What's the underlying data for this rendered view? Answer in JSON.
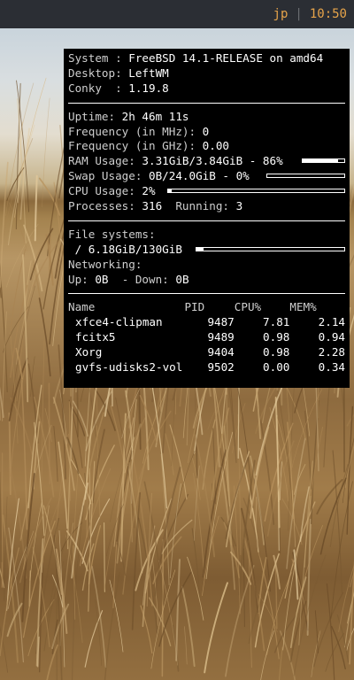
{
  "topbar": {
    "user": "jp",
    "separator": "|",
    "clock": "10:50"
  },
  "conky": {
    "system_label": "System :",
    "system_value": "FreeBSD 14.1-RELEASE on amd64",
    "desktop_label": "Desktop:",
    "desktop_value": "LeftWM",
    "conky_label": "Conky  :",
    "conky_value": "1.19.8",
    "uptime_label": "Uptime:",
    "uptime_value": "2h 46m 11s",
    "freq_mhz_label": "Frequency (in MHz):",
    "freq_mhz_value": "0",
    "freq_ghz_label": "Frequency (in GHz):",
    "freq_ghz_value": "0.00",
    "ram_label": "RAM Usage:",
    "ram_value": "3.31GiB/3.84GiB - 86%",
    "ram_fraction": 0.86,
    "swap_label": "Swap Usage:",
    "swap_value": "0B/24.0GiB - 0%",
    "swap_fraction": 0.0,
    "cpu_label": "CPU Usage:",
    "cpu_value": "2%",
    "cpu_fraction": 0.02,
    "processes_label": "Processes:",
    "processes_value": "316",
    "running_label": "Running:",
    "running_value": "3",
    "fs_label": "File systems:",
    "fs_value": "/ 6.18GiB/130GiB",
    "fs_fraction": 0.048,
    "net_label": "Networking:",
    "up_label": "Up:",
    "up_value": "0B",
    "down_label": "- Down:",
    "down_value": "0B",
    "proc_headers": {
      "name": "Name",
      "pid": "PID",
      "cpu": "CPU%",
      "mem": "MEM%"
    },
    "proc_rows": [
      {
        "name": "xfce4-clipman",
        "pid": "9487",
        "cpu": "7.81",
        "mem": "2.14"
      },
      {
        "name": "fcitx5",
        "pid": "9489",
        "cpu": "0.98",
        "mem": "0.94"
      },
      {
        "name": "Xorg",
        "pid": "9404",
        "cpu": "0.98",
        "mem": "2.28"
      },
      {
        "name": "gvfs-udisks2-vol",
        "pid": "9502",
        "cpu": "0.00",
        "mem": "0.34"
      }
    ]
  }
}
